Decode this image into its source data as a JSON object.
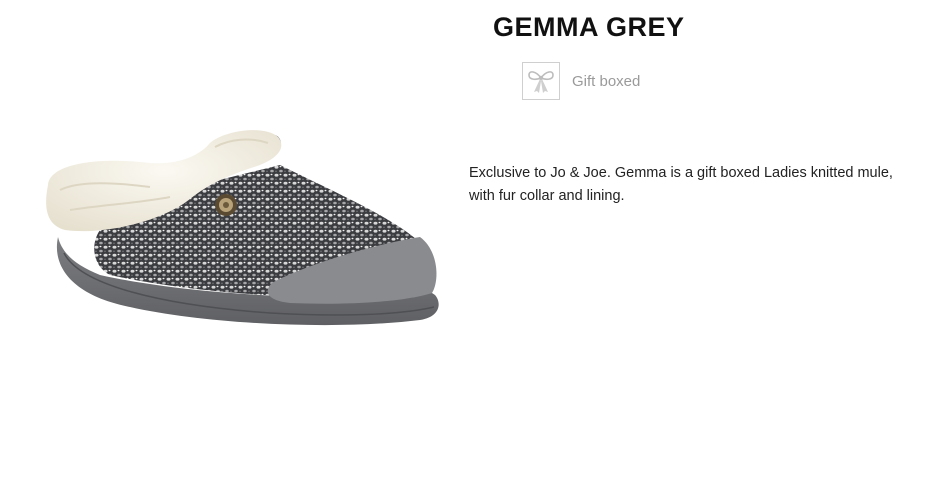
{
  "product": {
    "title": "GEMMA GREY",
    "gift_label": "Gift boxed",
    "gift_icon": "bow-icon",
    "image_subject": "slipper-image",
    "description": "Exclusive to Jo & Joe. Gemma is a gift boxed Ladies knitted mule, with fur collar and lining."
  },
  "colors": {
    "title": "#111111",
    "gift_label": "#9a9a9a",
    "body_text": "#222222",
    "suede": "#85868a",
    "fur": "#f3efe4",
    "knit_dark": "#3b3c40"
  }
}
